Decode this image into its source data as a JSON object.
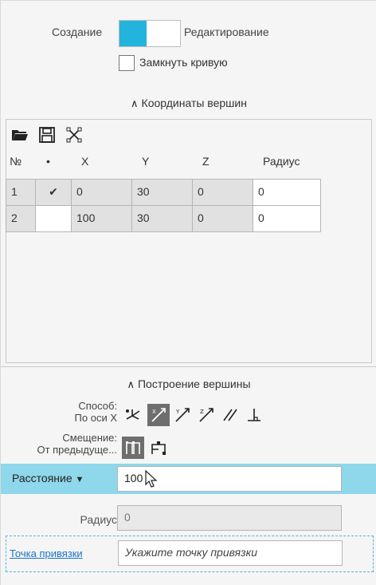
{
  "mode": {
    "left_label": "Создание",
    "right_label": "Редактирование"
  },
  "close_curve": {
    "label": "Замкнуть кривую",
    "checked": false
  },
  "coords": {
    "header": "Координаты вершин",
    "columns": [
      "№",
      "•",
      "X",
      "Y",
      "Z",
      "Радиус"
    ],
    "rows": [
      {
        "n": "1",
        "mark": "✔",
        "x": "0",
        "y": "30",
        "z": "0",
        "r": "0"
      },
      {
        "n": "2",
        "mark": "",
        "x": "100",
        "y": "30",
        "z": "0",
        "r": "0"
      }
    ],
    "toolbar_icons": [
      "folder-open-icon",
      "save-icon",
      "tangent-points-icon"
    ]
  },
  "build": {
    "header": "Построение вершины",
    "method_label": "Способ:",
    "method_value": "По оси X",
    "offset_label": "Смещение:",
    "offset_value": "От предыдуще...",
    "distance_label": "Расстояние",
    "distance_value": "100",
    "radius_label": "Радиус",
    "radius_value": "0",
    "snap_link": "Точка привязки",
    "snap_placeholder": "Укажите точку привязки"
  },
  "colors": {
    "accent": "#22b4dc",
    "highlight_bar": "#8fd7ea",
    "active_icon": "#6e6e6e"
  }
}
